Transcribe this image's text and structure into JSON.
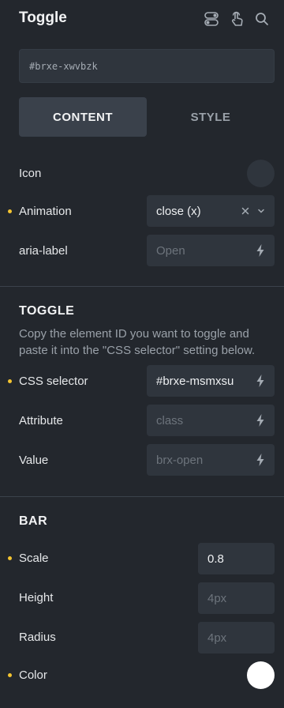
{
  "header": {
    "title": "Toggle",
    "icons": [
      "toggle-switch-icon",
      "pointer-hand-icon",
      "search-icon"
    ]
  },
  "element_id": "#brxe-xwvbzk",
  "tabs": [
    {
      "label": "CONTENT",
      "active": true
    },
    {
      "label": "STYLE",
      "active": false
    }
  ],
  "content": {
    "icon_label": "Icon",
    "animation_label": "Animation",
    "animation_value": "close (x)",
    "aria_label": "aria-label",
    "aria_placeholder": "Open"
  },
  "toggle_section": {
    "title": "TOGGLE",
    "description": "Copy the element ID you want to toggle and paste it into the \"CSS selector\" setting below.",
    "css_selector_label": "CSS selector",
    "css_selector_value": "#brxe-msmxsu",
    "attribute_label": "Attribute",
    "attribute_placeholder": "class",
    "value_label": "Value",
    "value_placeholder": "brx-open"
  },
  "bar_section": {
    "title": "BAR",
    "scale_label": "Scale",
    "scale_value": "0.8",
    "height_label": "Height",
    "height_placeholder": "4px",
    "radius_label": "Radius",
    "radius_placeholder": "4px",
    "color_label": "Color",
    "color_value": "#ffffff"
  },
  "colors": {
    "modified_dot": "#f4c430",
    "background": "#23272d",
    "input_bg": "#2f353d"
  }
}
